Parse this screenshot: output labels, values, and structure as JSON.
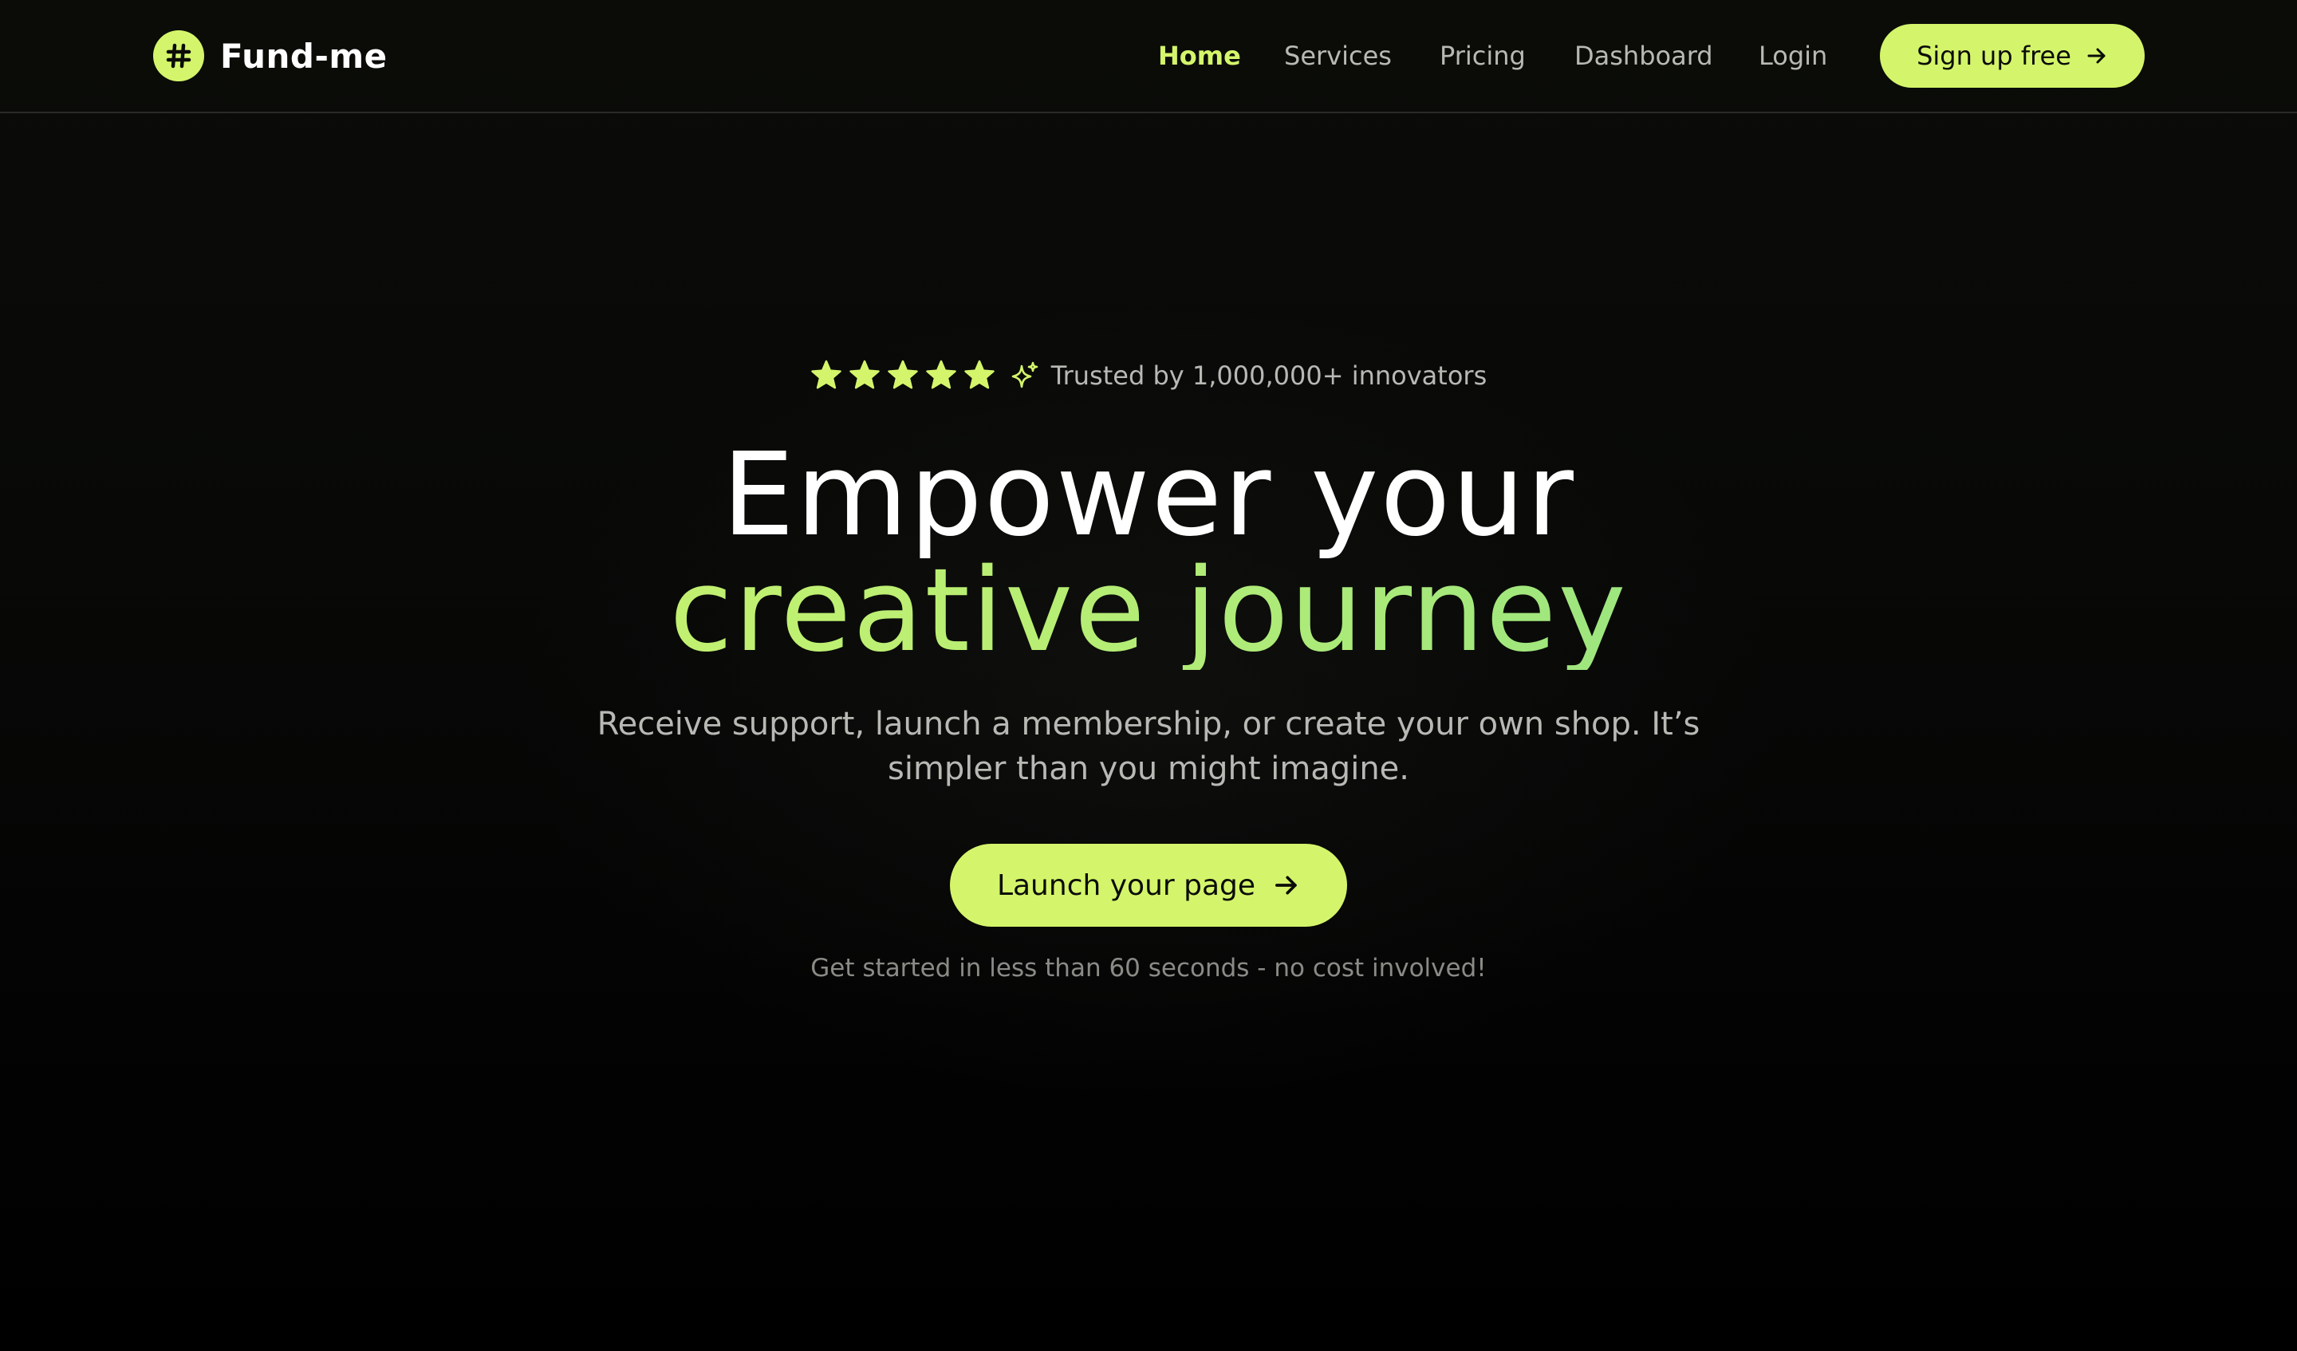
{
  "colors": {
    "accent": "#d4f56b",
    "accent_gradient_end": "#7fdc8a",
    "background": "#0b0c08",
    "muted_text": "#b8b9b4",
    "note_text": "#8a8b86"
  },
  "header": {
    "brand": {
      "icon": "hash-icon",
      "name": "Fund-me"
    },
    "nav": [
      {
        "label": "Home",
        "active": true
      },
      {
        "label": "Services",
        "active": false
      },
      {
        "label": "Pricing",
        "active": false
      },
      {
        "label": "Dashboard",
        "active": false
      },
      {
        "label": "Login",
        "active": false
      }
    ],
    "signup": {
      "label": "Sign up free",
      "icon": "arrow-right-icon"
    }
  },
  "hero": {
    "rating": {
      "stars": 5,
      "star_icon": "star-icon",
      "badge_icon": "sparkle-icon",
      "text": "Trusted by 1,000,000+ innovators"
    },
    "headline_line1": "Empower your",
    "headline_line2": "creative journey",
    "subtext": "Receive support, launch a membership, or create your own shop. It’s simpler than you might imagine.",
    "cta": {
      "label": "Launch your page",
      "icon": "arrow-right-icon"
    },
    "note": "Get started in less than 60 seconds - no cost involved!"
  }
}
